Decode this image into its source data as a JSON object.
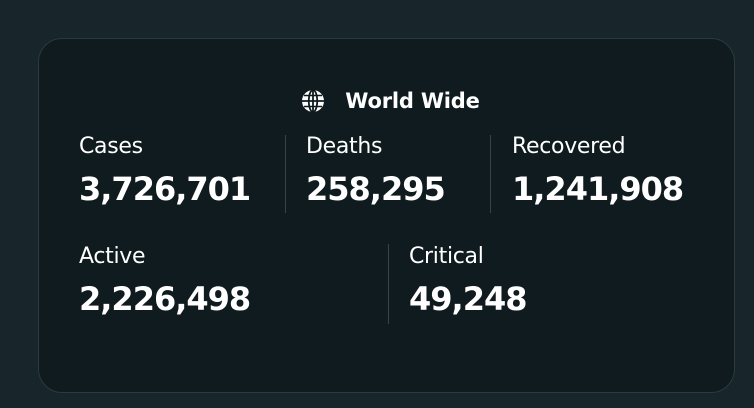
{
  "header": {
    "icon": "globe-icon",
    "title": "World Wide"
  },
  "stats": {
    "cases": {
      "label": "Cases",
      "value": "3,726,701"
    },
    "deaths": {
      "label": "Deaths",
      "value": "258,295"
    },
    "recovered": {
      "label": "Recovered",
      "value": "1,241,908"
    },
    "active": {
      "label": "Active",
      "value": "2,226,498"
    },
    "critical": {
      "label": "Critical",
      "value": "49,248"
    }
  },
  "colors": {
    "background": "#18252a",
    "card": "#0f1b1e",
    "border": "#2a3b40",
    "text": "#ffffff"
  }
}
